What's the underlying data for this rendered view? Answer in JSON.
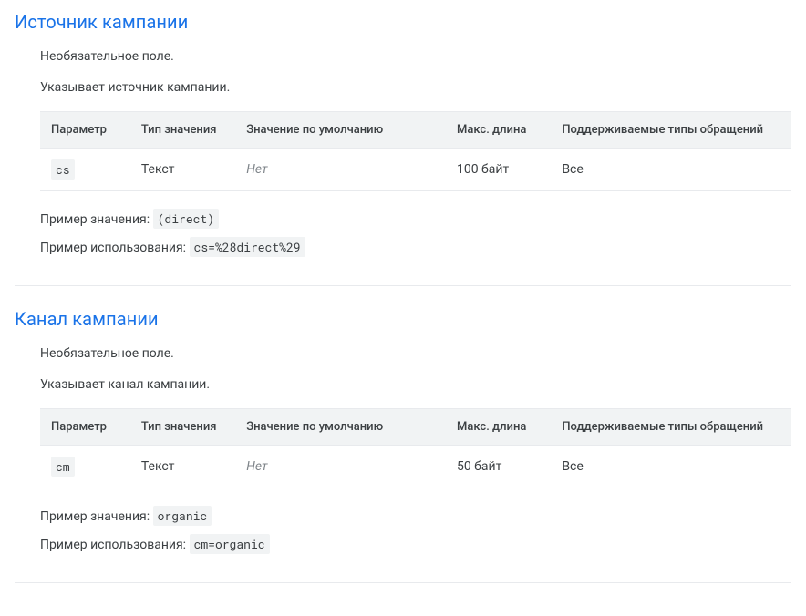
{
  "headers": {
    "param": "Параметр",
    "type": "Тип значения",
    "default": "Значение по умолчанию",
    "maxlen": "Макс. длина",
    "supported": "Поддерживаемые типы обращений"
  },
  "labels": {
    "example_value": "Пример значения: ",
    "example_usage": "Пример использования: "
  },
  "sections": [
    {
      "title": "Источник кампании",
      "optional": "Необязательное поле.",
      "desc": "Указывает источник кампании.",
      "table": {
        "param": "cs",
        "type": "Текст",
        "default": "Нет",
        "maxlen": "100 байт",
        "supported": "Все"
      },
      "example_value": "(direct)",
      "example_usage": "cs=%28direct%29"
    },
    {
      "title": "Канал кампании",
      "optional": "Необязательное поле.",
      "desc": "Указывает канал кампании.",
      "table": {
        "param": "cm",
        "type": "Текст",
        "default": "Нет",
        "maxlen": "50 байт",
        "supported": "Все"
      },
      "example_value": "organic",
      "example_usage": "cm=organic"
    }
  ]
}
